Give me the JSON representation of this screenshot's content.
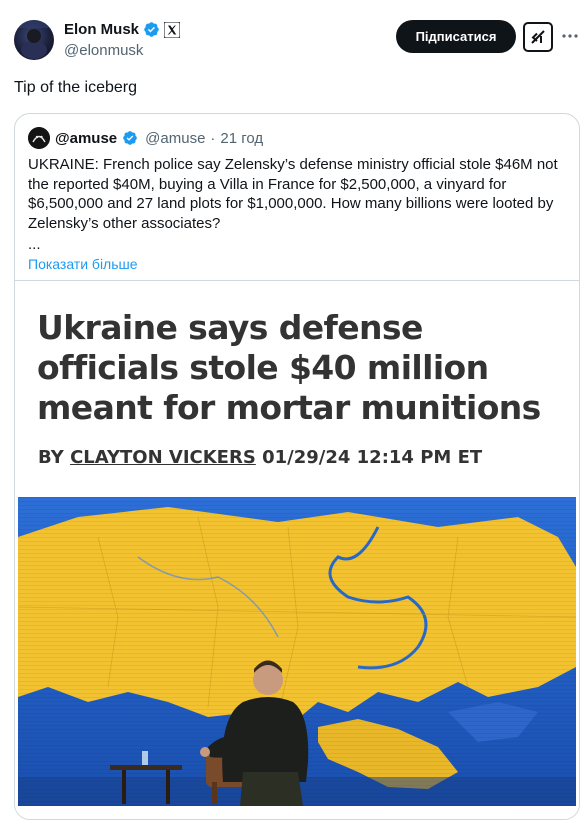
{
  "author": {
    "display_name": "Elon Musk",
    "handle": "@elonmusk"
  },
  "actions": {
    "follow_label": "Підписатися"
  },
  "tweet": {
    "text": "Tip of the iceberg"
  },
  "quoted": {
    "display_name": "@amuse",
    "handle": "@amuse",
    "separator": "·",
    "time": "21 год",
    "body": "UKRAINE: French police say Zelensky’s defense ministry official stole $46M not the reported $40M, buying a Villa in France for $2,500,000, a vinyard for $6,500,000 and 27 land plots for $1,000,000. How many billions were looted by Zelensky’s other associates?",
    "ellipsis": "...",
    "show_more": "Показати більше",
    "media": {
      "headline": "Ukraine says defense officials stole $40 million meant for mortar munitions",
      "byline_prefix": "BY",
      "byline_author": "CLAYTON VICKERS",
      "byline_date": "01/29/24 12:14 PM ET"
    }
  },
  "icons": {
    "verified": "verified-badge-icon",
    "affiliate": "x-logo-icon",
    "grok": "grok-icon",
    "more": "more-dots-icon"
  },
  "colors": {
    "accent": "#1d9bf0",
    "text": "#0f1419",
    "muted": "#536471",
    "border": "#cfd9de",
    "map_yellow": "#f2c230",
    "map_blue": "#1d5ec4"
  }
}
